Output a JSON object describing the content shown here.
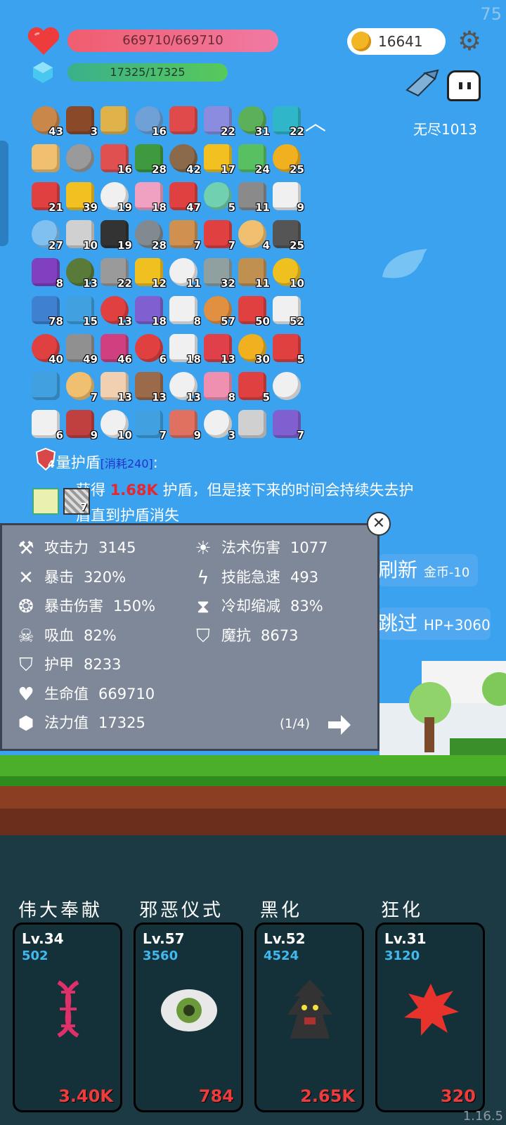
{
  "hud": {
    "fps": "75",
    "hp_text": "669710/669710",
    "mp_text": "17325/17325",
    "gold": "16641",
    "endless_label": "无尽1013"
  },
  "items": [
    {
      "n": "43",
      "c": "#c9874a"
    },
    {
      "n": "3",
      "c": "#8a4a2a"
    },
    {
      "n": "",
      "c": "#e0b24a"
    },
    {
      "n": "16",
      "c": "#6fa0d6"
    },
    {
      "n": "",
      "c": "#e04a4a"
    },
    {
      "n": "22",
      "c": "#8b8be0"
    },
    {
      "n": "31",
      "c": "#5cb05a"
    },
    {
      "n": "22",
      "c": "#2fb7c9"
    },
    {
      "n": "",
      "c": "#f0c070"
    },
    {
      "n": "",
      "c": "#9a9a9a"
    },
    {
      "n": "16",
      "c": "#e05050"
    },
    {
      "n": "28",
      "c": "#3f9a3f"
    },
    {
      "n": "42",
      "c": "#8a6a4a"
    },
    {
      "n": "17",
      "c": "#f2c020"
    },
    {
      "n": "24",
      "c": "#58c060"
    },
    {
      "n": "25",
      "c": "#f0b020"
    },
    {
      "n": "21",
      "c": "#e04040"
    },
    {
      "n": "39",
      "c": "#f2c020"
    },
    {
      "n": "19",
      "c": "#f0f0f0"
    },
    {
      "n": "18",
      "c": "#f0a0c0"
    },
    {
      "n": "47",
      "c": "#e04040"
    },
    {
      "n": "5",
      "c": "#70d0b0"
    },
    {
      "n": "11",
      "c": "#8a8a8a"
    },
    {
      "n": "9",
      "c": "#f0f0f0"
    },
    {
      "n": "27",
      "c": "#80c0f0"
    },
    {
      "n": "10",
      "c": "#d0d0d0"
    },
    {
      "n": "19",
      "c": "#333333"
    },
    {
      "n": "28",
      "c": "#808a90"
    },
    {
      "n": "7",
      "c": "#d09050"
    },
    {
      "n": "7",
      "c": "#e04040"
    },
    {
      "n": "4",
      "c": "#f0c070"
    },
    {
      "n": "25",
      "c": "#555555"
    },
    {
      "n": "8",
      "c": "#8040c0"
    },
    {
      "n": "13",
      "c": "#5a7a3a"
    },
    {
      "n": "22",
      "c": "#9a9a9a"
    },
    {
      "n": "12",
      "c": "#f0c020"
    },
    {
      "n": "11",
      "c": "#f0f0f0"
    },
    {
      "n": "32",
      "c": "#90a0a0"
    },
    {
      "n": "11",
      "c": "#c09050"
    },
    {
      "n": "10",
      "c": "#f0c020"
    },
    {
      "n": "78",
      "c": "#4080d0"
    },
    {
      "n": "15",
      "c": "#40a0e0"
    },
    {
      "n": "13",
      "c": "#e04040"
    },
    {
      "n": "18",
      "c": "#8060d0"
    },
    {
      "n": "8",
      "c": "#f0f0f0"
    },
    {
      "n": "57",
      "c": "#e09040"
    },
    {
      "n": "50",
      "c": "#e04040"
    },
    {
      "n": "52",
      "c": "#f0f0f0"
    },
    {
      "n": "40",
      "c": "#e04040"
    },
    {
      "n": "49",
      "c": "#909090"
    },
    {
      "n": "46",
      "c": "#d04080"
    },
    {
      "n": "6",
      "c": "#e04040"
    },
    {
      "n": "18",
      "c": "#f0f0f0"
    },
    {
      "n": "13",
      "c": "#e0404a"
    },
    {
      "n": "30",
      "c": "#f0b020"
    },
    {
      "n": "5",
      "c": "#e04040"
    },
    {
      "n": "",
      "c": "#40a0e0"
    },
    {
      "n": "7",
      "c": "#f0c070"
    },
    {
      "n": "13",
      "c": "#f0d0b0"
    },
    {
      "n": "13",
      "c": "#9a6a4a"
    },
    {
      "n": "13",
      "c": "#f0f0f0"
    },
    {
      "n": "8",
      "c": "#f090b0"
    },
    {
      "n": "5",
      "c": "#e04040"
    },
    {
      "n": "",
      "c": "#f0f0f0"
    },
    {
      "n": "6",
      "c": "#f0f0f0"
    },
    {
      "n": "9",
      "c": "#c04040"
    },
    {
      "n": "10",
      "c": "#f0f0f0"
    },
    {
      "n": "7",
      "c": "#40a0e0"
    },
    {
      "n": "9",
      "c": "#e07060"
    },
    {
      "n": "3",
      "c": "#f0f0f0"
    },
    {
      "n": "",
      "c": "#d0d0d0"
    },
    {
      "n": "7",
      "c": "#8060d0"
    }
  ],
  "description": {
    "icon_count": "4",
    "title": "量护盾",
    "cost": "[消耗240]",
    "colon": ":",
    "line1_pre": "获得 ",
    "line1_val": "1.68K",
    "line1_post": " 护盾，但是接下来的时间会持续失去护",
    "line2": "盾直到护盾消失",
    "badge_count": "7"
  },
  "stats_left": [
    {
      "label": "攻击力",
      "value": "3145",
      "icon": "axe-icon"
    },
    {
      "label": "暴击",
      "value": "320%",
      "icon": "crossed-swords-icon"
    },
    {
      "label": "暴击伤害",
      "value": "150%",
      "icon": "burst-circle-icon"
    },
    {
      "label": "吸血",
      "value": "82%",
      "icon": "skull-icon"
    },
    {
      "label": "护甲",
      "value": "8233",
      "icon": "shield-icon"
    },
    {
      "label": "生命值",
      "value": "669710",
      "icon": "heart-icon"
    },
    {
      "label": "法力值",
      "value": "17325",
      "icon": "crystal-icon"
    }
  ],
  "stats_right": [
    {
      "label": "法术伤害",
      "value": "1077",
      "icon": "sun-icon"
    },
    {
      "label": "技能急速",
      "value": "493",
      "icon": "lightning-icon"
    },
    {
      "label": "冷却缩减",
      "value": "83%",
      "icon": "hourglass-icon"
    },
    {
      "label": "魔抗",
      "value": "8673",
      "icon": "magic-shield-icon"
    }
  ],
  "panel": {
    "page": "(1/4)"
  },
  "buttons": {
    "refresh_main": "刷新",
    "refresh_sub": "金币-10",
    "skip_main": "跳过",
    "skip_sub": "HP+3060"
  },
  "cards": [
    {
      "title": "伟大奉献",
      "lv": "Lv.34",
      "cost": "502",
      "value": "3.40K",
      "icon": "dna-icon"
    },
    {
      "title": "邪恶仪式",
      "lv": "Lv.57",
      "cost": "3560",
      "value": "784",
      "icon": "eye-icon"
    },
    {
      "title": "黑化",
      "lv": "Lv.52",
      "cost": "4524",
      "value": "2.65K",
      "icon": "dark-tree-icon"
    },
    {
      "title": "狂化",
      "lv": "Lv.31",
      "cost": "3120",
      "value": "320",
      "icon": "blood-splat-icon"
    }
  ],
  "version": "1.16.5",
  "colors": {
    "hp": "#f05d6f",
    "mp": "#58c95a",
    "sky": "#3aa2ee",
    "cost_blue": "#40b8f0",
    "value_red": "#ee3b3b"
  }
}
